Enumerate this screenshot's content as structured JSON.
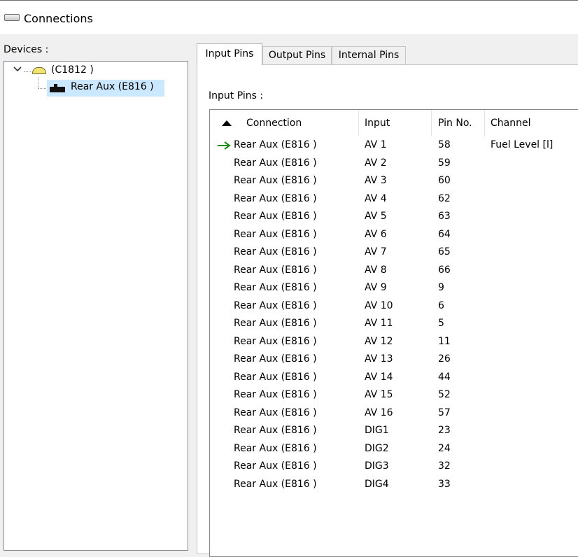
{
  "window": {
    "title": "Connections",
    "icon": "connections-window-icon"
  },
  "devices": {
    "label": "Devices :",
    "tree": {
      "root": {
        "label": "(C1812 )",
        "icon": "controller-icon",
        "expanded": true
      },
      "child": {
        "label": "Rear Aux (E816 )",
        "icon": "module-icon",
        "selected": true
      }
    }
  },
  "tabs": [
    {
      "label": "Input Pins",
      "active": true
    },
    {
      "label": "Output Pins",
      "active": false
    },
    {
      "label": "Internal Pins",
      "active": false
    }
  ],
  "input_pins": {
    "label": "Input Pins :",
    "columns": [
      "Connection",
      "Input",
      "Pin No.",
      "Channel"
    ],
    "sort": "ascending",
    "rows": [
      {
        "connection": "Rear Aux (E816 )",
        "input": "AV 1",
        "pin": "58",
        "channel": "Fuel Level [l]",
        "marker": true
      },
      {
        "connection": "Rear Aux (E816 )",
        "input": "AV 2",
        "pin": "59",
        "channel": ""
      },
      {
        "connection": "Rear Aux (E816 )",
        "input": "AV 3",
        "pin": "60",
        "channel": ""
      },
      {
        "connection": "Rear Aux (E816 )",
        "input": "AV 4",
        "pin": "62",
        "channel": ""
      },
      {
        "connection": "Rear Aux (E816 )",
        "input": "AV 5",
        "pin": "63",
        "channel": ""
      },
      {
        "connection": "Rear Aux (E816 )",
        "input": "AV 6",
        "pin": "64",
        "channel": ""
      },
      {
        "connection": "Rear Aux (E816 )",
        "input": "AV 7",
        "pin": "65",
        "channel": ""
      },
      {
        "connection": "Rear Aux (E816 )",
        "input": "AV 8",
        "pin": "66",
        "channel": ""
      },
      {
        "connection": "Rear Aux (E816 )",
        "input": "AV 9",
        "pin": "9",
        "channel": ""
      },
      {
        "connection": "Rear Aux (E816 )",
        "input": "AV 10",
        "pin": "6",
        "channel": ""
      },
      {
        "connection": "Rear Aux (E816 )",
        "input": "AV 11",
        "pin": "5",
        "channel": ""
      },
      {
        "connection": "Rear Aux (E816 )",
        "input": "AV 12",
        "pin": "11",
        "channel": ""
      },
      {
        "connection": "Rear Aux (E816 )",
        "input": "AV 13",
        "pin": "26",
        "channel": ""
      },
      {
        "connection": "Rear Aux (E816 )",
        "input": "AV 14",
        "pin": "44",
        "channel": ""
      },
      {
        "connection": "Rear Aux (E816 )",
        "input": "AV 15",
        "pin": "52",
        "channel": ""
      },
      {
        "connection": "Rear Aux (E816 )",
        "input": "AV 16",
        "pin": "57",
        "channel": ""
      },
      {
        "connection": "Rear Aux (E816 )",
        "input": "DIG1",
        "pin": "23",
        "channel": ""
      },
      {
        "connection": "Rear Aux (E816 )",
        "input": "DIG2",
        "pin": "24",
        "channel": ""
      },
      {
        "connection": "Rear Aux (E816 )",
        "input": "DIG3",
        "pin": "32",
        "channel": ""
      },
      {
        "connection": "Rear Aux (E816 )",
        "input": "DIG4",
        "pin": "33",
        "channel": ""
      }
    ]
  },
  "colors": {
    "selection": "#cce8ff",
    "marker_arrow": "#1e8a1e",
    "border": "#828790"
  }
}
